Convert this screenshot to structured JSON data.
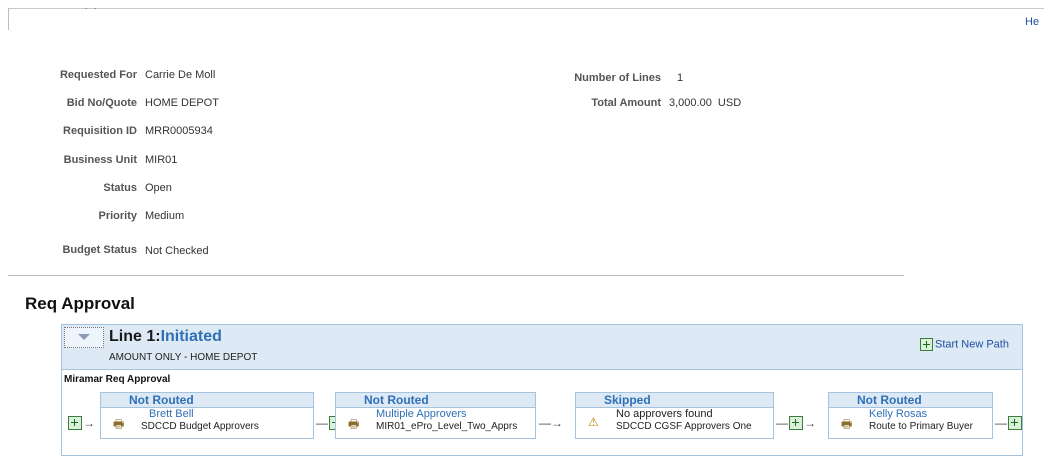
{
  "header": {
    "help_label": "He",
    "dots": ". ."
  },
  "fields_left": [
    {
      "label": "Requested For",
      "value": "Carrie De Moll"
    },
    {
      "label": "Bid No/Quote",
      "value": "HOME DEPOT"
    },
    {
      "label": "Requisition ID",
      "value": "MRR0005934"
    },
    {
      "label": "Business Unit",
      "value": "MIR01"
    },
    {
      "label": "Status",
      "value": "Open"
    },
    {
      "label": "Priority",
      "value": "Medium"
    },
    {
      "label": "Budget Status",
      "value": "Not Checked"
    }
  ],
  "fields_right": [
    {
      "label": "Number of Lines",
      "value": "1"
    },
    {
      "label": "Total Amount",
      "value": "3,000.00  USD"
    }
  ],
  "approval": {
    "section_title": "Req Approval",
    "line_label": "Line 1:",
    "line_status": "Initiated",
    "line_desc": "AMOUNT ONLY - HOME DEPOT",
    "start_new_path": "Start New Path",
    "path_name": "Miramar Req Approval",
    "stages": [
      {
        "status": "Not Routed",
        "name": "Brett Bell",
        "desc": "SDCCD Budget Approvers",
        "icon": "printer-icon"
      },
      {
        "status": "Not Routed",
        "name": "Multiple Approvers",
        "desc": "MIR01_ePro_Level_Two_Apprs",
        "icon": "printer-icon"
      },
      {
        "status": "Skipped",
        "name": "No approvers found",
        "desc": "SDCCD CGSF Approvers One",
        "icon": "warning-icon"
      },
      {
        "status": "Not Routed",
        "name": "Kelly Rosas",
        "desc": "Route to Primary Buyer",
        "icon": "printer-icon"
      }
    ]
  },
  "colors": {
    "link": "#1f4fa0",
    "status_blue": "#2f6fb5",
    "panel_head": "#dde9f5",
    "panel_border": "#a6c3de"
  }
}
